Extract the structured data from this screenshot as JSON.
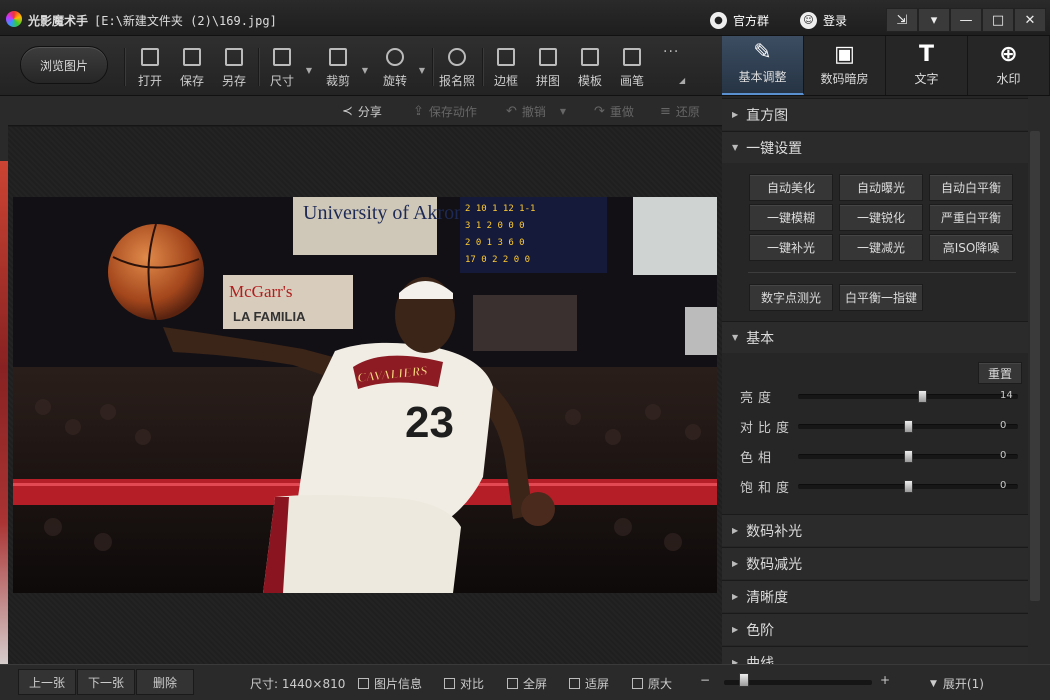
{
  "window": {
    "app_name": "光影魔术手",
    "file_path": "[E:\\新建文件夹 (2)\\169.jpg]",
    "group_label": "官方群",
    "login_label": "登录",
    "controls": [
      "⇲",
      "▾",
      "—",
      "□",
      "✕"
    ]
  },
  "toolbar": {
    "browse_label": "浏览图片",
    "tools": [
      "打开",
      "保存",
      "另存",
      "尺寸",
      "裁剪",
      "旋转",
      "报名照",
      "边框",
      "拼图",
      "模板",
      "画笔"
    ],
    "more": "···"
  },
  "panel_tabs": [
    "基本调整",
    "数码暗房",
    "文字",
    "水印"
  ],
  "subbar": {
    "share": "分享",
    "save_action": "保存动作",
    "undo": "撤销",
    "redo": "重做",
    "restore": "还原"
  },
  "photo": {
    "banner_school": "University of Akron",
    "banner_mcgarr": "McGarr's",
    "banner_lafamilia": "LA FAMILIA",
    "jersey_team": "CAVALIERS",
    "jersey_number": "23",
    "scoreboard_rows": [
      "2 10 1 12 1-1",
      "3 1 2 0 0 0",
      "2 0 1 3 6 0",
      "17 0 2 2 0 0"
    ]
  },
  "right_panel": {
    "sections": {
      "histogram": "直方图",
      "one_click": "一键设置",
      "basic": "基本",
      "digital_fill": "数码补光",
      "digital_reduce": "数码减光",
      "clarity": "清晰度",
      "levels": "色阶",
      "curves": "曲线"
    },
    "one_click_buttons": [
      "自动美化",
      "自动曝光",
      "自动白平衡",
      "一键模糊",
      "一键锐化",
      "严重白平衡",
      "一键补光",
      "一键减光",
      "高ISO降噪"
    ],
    "extra_buttons": [
      "数字点测光",
      "白平衡一指键"
    ],
    "reset_label": "重置",
    "sliders": [
      {
        "label": "亮度",
        "value": "14",
        "fraction": 0.57
      },
      {
        "label": "对比度",
        "value": "0",
        "fraction": 0.5
      },
      {
        "label": "色相",
        "value": "0",
        "fraction": 0.5
      },
      {
        "label": "饱和度",
        "value": "0",
        "fraction": 0.5
      }
    ]
  },
  "statusbar": {
    "prev": "上一张",
    "next": "下一张",
    "delete": "删除",
    "size": "尺寸: 1440×810",
    "info": "图片信息",
    "compare": "对比",
    "fullscreen": "全屏",
    "fit": "适屏",
    "original": "原大",
    "zoom_minus": "−",
    "zoom_plus": "+",
    "expand": "展开(1)"
  }
}
